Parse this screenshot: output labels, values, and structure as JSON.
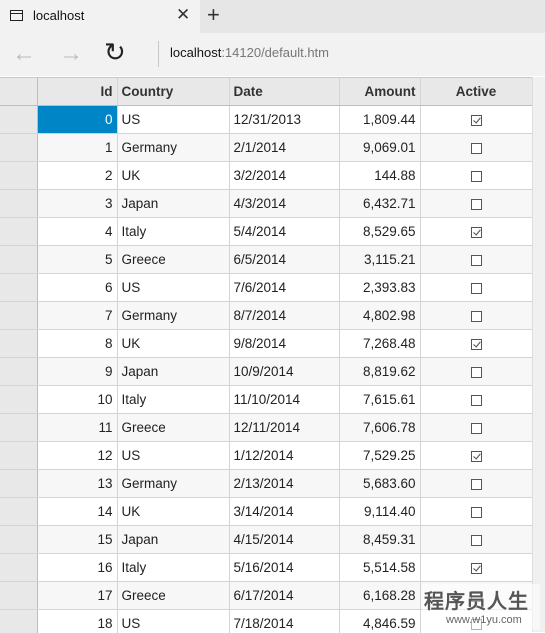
{
  "browser": {
    "tab_title": "localhost",
    "tab_close": "✕",
    "new_tab": "+",
    "back": "←",
    "forward": "→",
    "refresh": "↻",
    "address_host": "localhost",
    "address_rest": ":14120/default.htm"
  },
  "grid": {
    "headers": {
      "id": "Id",
      "country": "Country",
      "date": "Date",
      "amount": "Amount",
      "active": "Active"
    },
    "selected_row": 0,
    "rows": [
      {
        "id": "0",
        "country": "US",
        "date": "12/31/2013",
        "amount": "1,809.44",
        "active": true
      },
      {
        "id": "1",
        "country": "Germany",
        "date": "2/1/2014",
        "amount": "9,069.01",
        "active": false
      },
      {
        "id": "2",
        "country": "UK",
        "date": "3/2/2014",
        "amount": "144.88",
        "active": false
      },
      {
        "id": "3",
        "country": "Japan",
        "date": "4/3/2014",
        "amount": "6,432.71",
        "active": false
      },
      {
        "id": "4",
        "country": "Italy",
        "date": "5/4/2014",
        "amount": "8,529.65",
        "active": true
      },
      {
        "id": "5",
        "country": "Greece",
        "date": "6/5/2014",
        "amount": "3,115.21",
        "active": false
      },
      {
        "id": "6",
        "country": "US",
        "date": "7/6/2014",
        "amount": "2,393.83",
        "active": false
      },
      {
        "id": "7",
        "country": "Germany",
        "date": "8/7/2014",
        "amount": "4,802.98",
        "active": false
      },
      {
        "id": "8",
        "country": "UK",
        "date": "9/8/2014",
        "amount": "7,268.48",
        "active": true
      },
      {
        "id": "9",
        "country": "Japan",
        "date": "10/9/2014",
        "amount": "8,819.62",
        "active": false
      },
      {
        "id": "10",
        "country": "Italy",
        "date": "11/10/2014",
        "amount": "7,615.61",
        "active": false
      },
      {
        "id": "11",
        "country": "Greece",
        "date": "12/11/2014",
        "amount": "7,606.78",
        "active": false
      },
      {
        "id": "12",
        "country": "US",
        "date": "1/12/2014",
        "amount": "7,529.25",
        "active": true
      },
      {
        "id": "13",
        "country": "Germany",
        "date": "2/13/2014",
        "amount": "5,683.60",
        "active": false
      },
      {
        "id": "14",
        "country": "UK",
        "date": "3/14/2014",
        "amount": "9,114.40",
        "active": false
      },
      {
        "id": "15",
        "country": "Japan",
        "date": "4/15/2014",
        "amount": "8,459.31",
        "active": false
      },
      {
        "id": "16",
        "country": "Italy",
        "date": "5/16/2014",
        "amount": "5,514.58",
        "active": true
      },
      {
        "id": "17",
        "country": "Greece",
        "date": "6/17/2014",
        "amount": "6,168.28",
        "active": false
      },
      {
        "id": "18",
        "country": "US",
        "date": "7/18/2014",
        "amount": "4,846.59",
        "active": false
      }
    ]
  },
  "watermark": {
    "main": "程序员人生",
    "sub": "www.w1yu.com"
  },
  "colors": {
    "selected": "#0085c7",
    "header_bg": "#e8e8e8",
    "alt_row": "#f7f7f7"
  }
}
